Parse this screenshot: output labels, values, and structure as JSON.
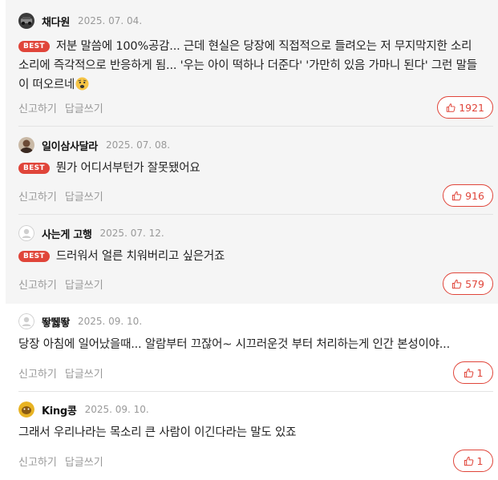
{
  "comments": [
    {
      "nick": "채다원",
      "date": "2025. 07. 04.",
      "best": true,
      "best_label": "BEST",
      "text": "저분 말씀에 100%공감... 근데 현실은 당장에 직접적으로 들려오는 저 무지막지한 소리 소리에 즉각적으로 반응하게 됨... '우는 아이 떡하나 더준다' '가만히 있음 가마니 된다' 그런 말들이 떠오르네",
      "emoji": "distressed-face-emoji",
      "report": "신고하기",
      "reply": "답글쓰기",
      "likes": "1921",
      "avatar": "car-photo-avatar"
    },
    {
      "nick": "일이삼사달라",
      "date": "2025. 07. 08.",
      "best": true,
      "best_label": "BEST",
      "text": "뭔가 어디서부턴가 잘못됐어요",
      "report": "신고하기",
      "reply": "답글쓰기",
      "likes": "916",
      "avatar": "portrait-avatar"
    },
    {
      "nick": "사는게 고행",
      "date": "2025. 07. 12.",
      "best": true,
      "best_label": "BEST",
      "text": "드러워서 얼른 치워버리고 싶은거죠",
      "report": "신고하기",
      "reply": "답글쓰기",
      "likes": "579",
      "avatar": "default-user-avatar"
    },
    {
      "nick": "뙇뛣뙇",
      "date": "2025. 09. 10.",
      "best": false,
      "text": "당장 아침에 일어났을때... 알람부터 끄잖어~ 시끄러운것 부터 처리하는게 인간 본성이야...",
      "report": "신고하기",
      "reply": "답글쓰기",
      "likes": "1",
      "avatar": "default-user-avatar"
    },
    {
      "nick": "King콩",
      "date": "2025. 09. 10.",
      "best": false,
      "text": "그래서 우리나라는 목소리 큰 사람이 이긴다라는 말도 있죠",
      "report": "신고하기",
      "reply": "답글쓰기",
      "likes": "1",
      "avatar": "yellow-character-avatar"
    }
  ],
  "colors": {
    "accent": "#e0453a",
    "best_background": "#f5f5f5",
    "muted": "#999999"
  }
}
